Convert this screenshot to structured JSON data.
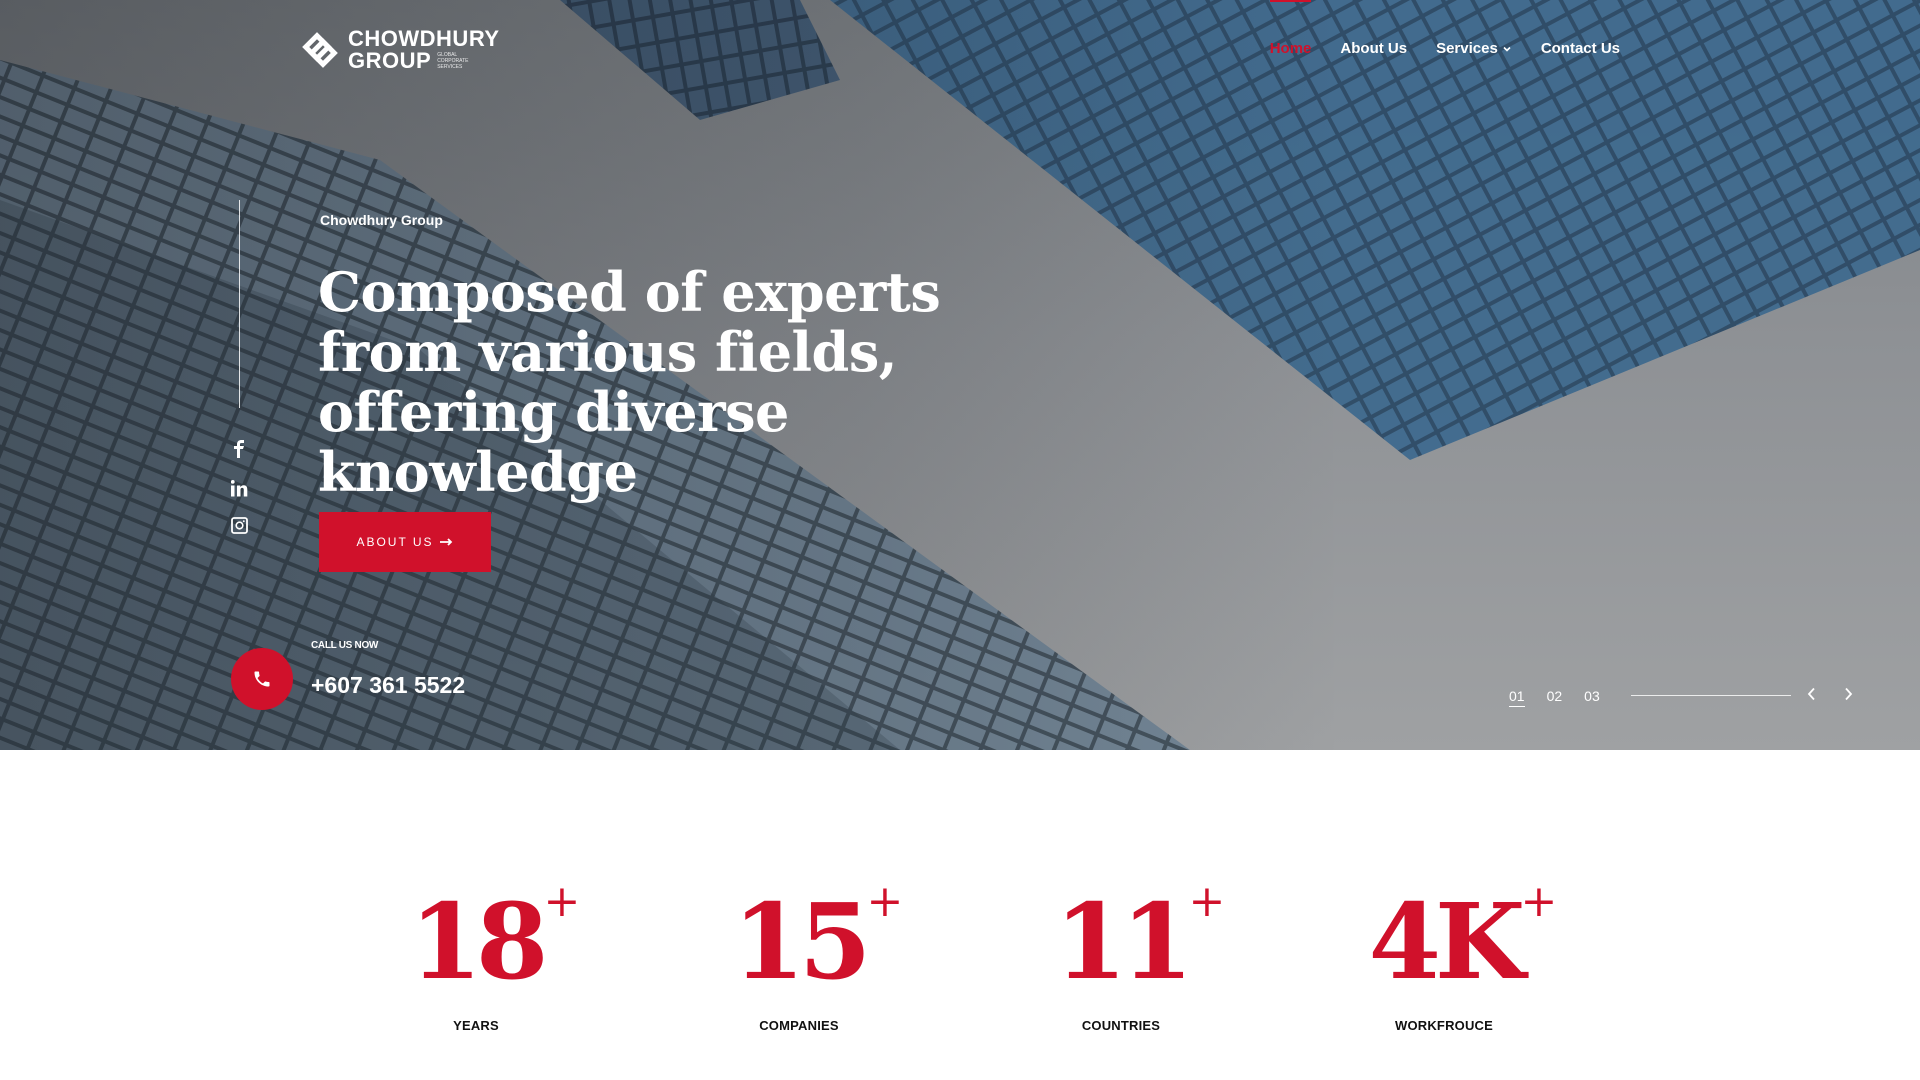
{
  "brand": {
    "name_line1": "CHOWDHURY",
    "name_line2": "GROUP",
    "tagline": "GLOBAL CORPORATE SERVICES",
    "accent_color": "#d0112b"
  },
  "nav": {
    "items": [
      {
        "label": "Home",
        "active": true
      },
      {
        "label": "About Us",
        "active": false
      },
      {
        "label": "Services",
        "active": false,
        "has_dropdown": true
      },
      {
        "label": "Contact Us",
        "active": false
      }
    ]
  },
  "social": {
    "icons": [
      "facebook-icon",
      "linkedin-icon",
      "instagram-icon"
    ]
  },
  "hero": {
    "eyebrow": "Chowdhury Group",
    "headline": "Composed of experts from various fields, offering diverse knowledge",
    "cta_label": "ABOUT US",
    "call_label": "CALL US NOW",
    "phone": "+607 361 5522"
  },
  "slider": {
    "slides": [
      "01",
      "02",
      "03"
    ],
    "active_index": 0
  },
  "stats": [
    {
      "value": "18",
      "suffix": "+",
      "label": "YEARS"
    },
    {
      "value": "15",
      "suffix": "+",
      "label": "COMPANIES"
    },
    {
      "value": "11",
      "suffix": "+",
      "label": "COUNTRIES"
    },
    {
      "value": "4K",
      "suffix": "+",
      "label": "WORKFROUCE"
    }
  ]
}
